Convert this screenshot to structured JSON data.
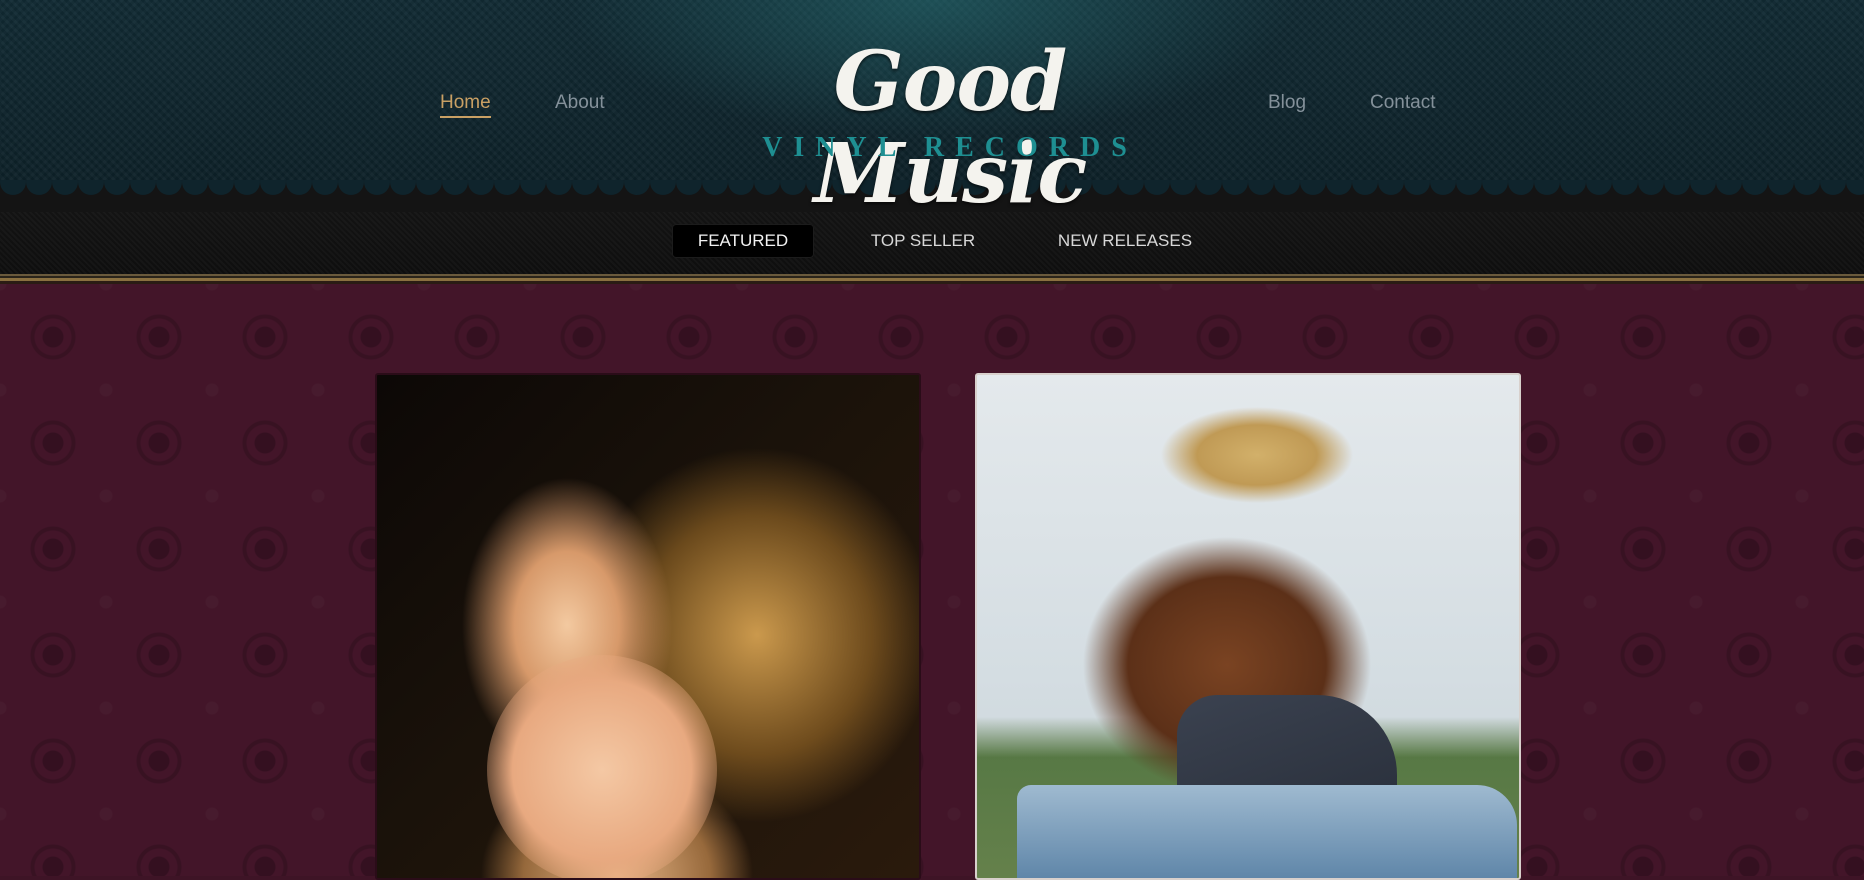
{
  "header": {
    "logo_title": "Good Music",
    "logo_subtitle": "VINYL RECORDS",
    "nav": [
      {
        "label": "Home",
        "active": true
      },
      {
        "label": "About",
        "active": false
      },
      {
        "label": "Blog",
        "active": false
      },
      {
        "label": "Contact",
        "active": false
      }
    ]
  },
  "subnav": {
    "tabs": [
      {
        "label": "FEATURED",
        "active": true
      },
      {
        "label": "TOP SELLER",
        "active": false
      },
      {
        "label": "NEW RELEASES",
        "active": false
      }
    ]
  },
  "featured": {
    "items": [
      {
        "image": "ballerina-photo"
      },
      {
        "image": "cowboy-photo"
      }
    ]
  },
  "colors": {
    "header_bg": "#0c1f26",
    "nav_active": "#c9a064",
    "nav_inactive": "#84919a",
    "logo_sub": "#1e8f92",
    "page_bg": "#431529"
  }
}
